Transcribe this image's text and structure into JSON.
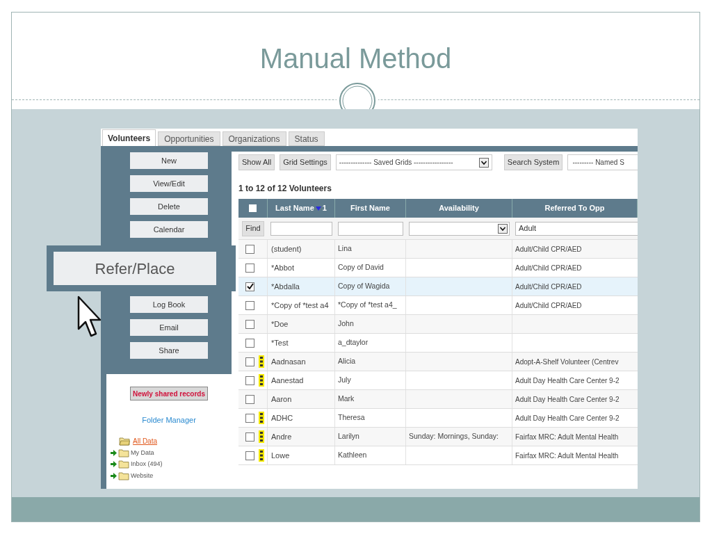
{
  "slide": {
    "title": "Manual Method"
  },
  "tabs": [
    {
      "label": "Volunteers",
      "selected": true
    },
    {
      "label": "Opportunities",
      "selected": false
    },
    {
      "label": "Organizations",
      "selected": false
    },
    {
      "label": "Status",
      "selected": false
    }
  ],
  "actions": [
    "New",
    "View/Edit",
    "Delete",
    "Calendar",
    "Log Book",
    "Email",
    "Share"
  ],
  "callout": {
    "label": "Refer/Place"
  },
  "folder_panel": {
    "shared_button": "Newly shared records",
    "link": "Folder Manager",
    "folders": [
      {
        "label": "All Data",
        "selected": true,
        "expanded": true
      },
      {
        "label": "My Data",
        "selected": false,
        "expanded": false
      },
      {
        "label": "Inbox (494)",
        "selected": false,
        "expanded": false
      },
      {
        "label": "Website",
        "selected": false,
        "expanded": false
      }
    ]
  },
  "toolbar": {
    "show_all": "Show All",
    "grid_settings": "Grid Settings",
    "saved_grids": "-------------- Saved Grids -----------------",
    "search_system": "Search System",
    "named_select": "--------- Named S"
  },
  "count": "1 to 12 of 12 Volunteers",
  "table": {
    "header_checked": false,
    "columns": [
      {
        "label": "Last Name",
        "sorted": true,
        "sort_rank": "1"
      },
      {
        "label": "First Name",
        "sorted": false
      },
      {
        "label": "Availability",
        "sorted": false
      },
      {
        "label": "Referred To Opp",
        "sorted": false
      }
    ],
    "filter": {
      "find": "Find",
      "referred_value": "Adult"
    },
    "rows": [
      {
        "checked": false,
        "new": false,
        "last": "(student)",
        "first": "Lina",
        "availability": "",
        "referred": "Adult/Child CPR/AED"
      },
      {
        "checked": false,
        "new": false,
        "last": "*Abbot",
        "first": "Copy of David",
        "availability": "",
        "referred": "Adult/Child CPR/AED"
      },
      {
        "checked": true,
        "new": false,
        "last": "*Abdalla",
        "first": "Copy of Wagida",
        "availability": "",
        "referred": "Adult/Child CPR/AED"
      },
      {
        "checked": false,
        "new": false,
        "last": "*Copy of *test a4",
        "first": "*Copy of *test a4_",
        "availability": "",
        "referred": "Adult/Child CPR/AED"
      },
      {
        "checked": false,
        "new": false,
        "last": "*Doe",
        "first": "John",
        "availability": "",
        "referred": ""
      },
      {
        "checked": false,
        "new": false,
        "last": "*Test",
        "first": "a_dtaylor",
        "availability": "",
        "referred": ""
      },
      {
        "checked": false,
        "new": true,
        "last": "Aadnasan",
        "first": "Alicia",
        "availability": "",
        "referred": "Adopt-A-Shelf Volunteer (Centrev"
      },
      {
        "checked": false,
        "new": true,
        "last": "Aanestad",
        "first": "July",
        "availability": "",
        "referred": "Adult Day Health Care Center 9-2"
      },
      {
        "checked": false,
        "new": false,
        "last": "Aaron",
        "first": "Mark",
        "availability": "",
        "referred": "Adult Day Health Care Center 9-2"
      },
      {
        "checked": false,
        "new": true,
        "last": "ADHC",
        "first": "Theresa",
        "availability": "",
        "referred": "Adult Day Health Care Center 9-2"
      },
      {
        "checked": false,
        "new": true,
        "last": "Andre",
        "first": "Larilyn",
        "availability": "Sunday: Mornings, Sunday:",
        "referred": "Fairfax MRC: Adult Mental Health"
      },
      {
        "checked": false,
        "new": true,
        "last": "Lowe",
        "first": "Kathleen",
        "availability": "",
        "referred": "Fairfax MRC: Adult Mental Health"
      }
    ]
  }
}
